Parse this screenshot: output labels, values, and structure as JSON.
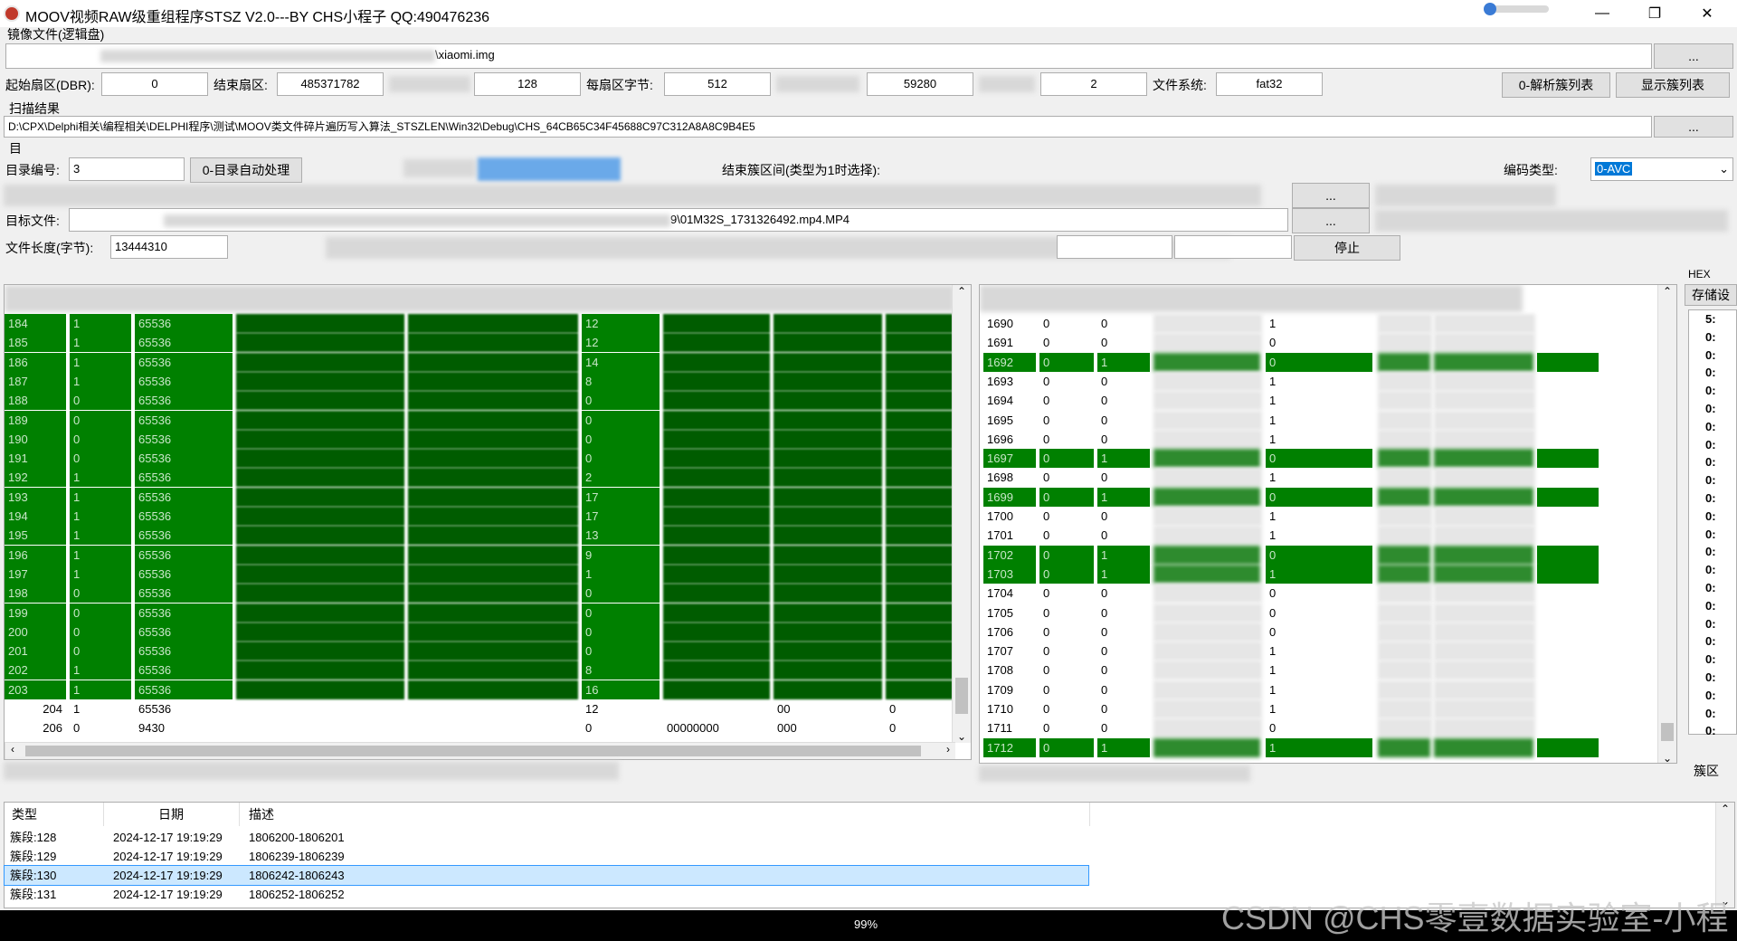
{
  "window": {
    "title": "MOOV视频RAW级重组程序STSZ V2.0---BY CHS小程子  QQ:490476236",
    "minimize": "—",
    "maximize": "❐",
    "close": "✕"
  },
  "image_section": {
    "label": "镜像文件(逻辑盘)",
    "path": "\\xiaomi.img",
    "browse": "..."
  },
  "params": {
    "start_sector_label": "起始扇区(DBR):",
    "start_sector": "0",
    "end_sector_label": "结束扇区:",
    "end_sector": "485371782",
    "field3": "128",
    "bytes_per_sector_label": "每扇区字节:",
    "bytes_per_sector": "512",
    "field5": "59280",
    "field6": "2",
    "fs_label": "文件系统:",
    "fs": "fat32",
    "parse_button": "0-解析簇列表",
    "show_button": "显示簇列表"
  },
  "scan": {
    "label": "扫描结果",
    "path": "D:\\CPX\\Delphi相关\\编程相关\\DELPHI程序\\测试\\MOOV类文件碎片遍历写入算法_STSZLEN\\Win32\\Debug\\CHS_64CB65C34F45688C97C312A8A8C9B4E5",
    "browse": "..."
  },
  "dir": {
    "small_label": "目",
    "dir_no_label": "目录编号:",
    "dir_no": "3",
    "auto_button": "0-目录自动处理",
    "end_range_label": "结束簇区间(类型为1时选择):",
    "encode_label": "编码类型:",
    "encode_value": "0-AVC"
  },
  "target": {
    "label": "目标文件:",
    "path": "9\\01M32S_1731326492.mp4.MP4",
    "browse1": "...",
    "browse2": "...",
    "length_label": "文件长度(字节):",
    "length": "13444310",
    "stop_button": "停止"
  },
  "left_grid": {
    "rows": [
      {
        "id": "184",
        "a": "1",
        "b": "65536",
        "c": "12",
        "green": true
      },
      {
        "id": "185",
        "a": "1",
        "b": "65536",
        "c": "12",
        "green": true
      },
      {
        "id": "186",
        "a": "1",
        "b": "65536",
        "c": "14",
        "green": true
      },
      {
        "id": "187",
        "a": "1",
        "b": "65536",
        "c": "8",
        "green": true
      },
      {
        "id": "188",
        "a": "0",
        "b": "65536",
        "c": "0",
        "green": true
      },
      {
        "id": "189",
        "a": "0",
        "b": "65536",
        "c": "0",
        "green": true
      },
      {
        "id": "190",
        "a": "0",
        "b": "65536",
        "c": "0",
        "green": true
      },
      {
        "id": "191",
        "a": "0",
        "b": "65536",
        "c": "0",
        "green": true
      },
      {
        "id": "192",
        "a": "1",
        "b": "65536",
        "c": "2",
        "green": true
      },
      {
        "id": "193",
        "a": "1",
        "b": "65536",
        "c": "17",
        "green": true
      },
      {
        "id": "194",
        "a": "1",
        "b": "65536",
        "c": "17",
        "green": true
      },
      {
        "id": "195",
        "a": "1",
        "b": "65536",
        "c": "13",
        "green": true
      },
      {
        "id": "196",
        "a": "1",
        "b": "65536",
        "c": "9",
        "green": true
      },
      {
        "id": "197",
        "a": "1",
        "b": "65536",
        "c": "1",
        "green": true
      },
      {
        "id": "198",
        "a": "0",
        "b": "65536",
        "c": "0",
        "green": true
      },
      {
        "id": "199",
        "a": "0",
        "b": "65536",
        "c": "0",
        "green": true
      },
      {
        "id": "200",
        "a": "0",
        "b": "65536",
        "c": "0",
        "green": true
      },
      {
        "id": "201",
        "a": "0",
        "b": "65536",
        "c": "0",
        "green": true
      },
      {
        "id": "202",
        "a": "1",
        "b": "65536",
        "c": "8",
        "green": true
      },
      {
        "id": "203",
        "a": "1",
        "b": "65536",
        "c": "16",
        "green": true
      },
      {
        "id": "204",
        "a": "1",
        "b": "65536",
        "c": "12",
        "green": false
      },
      {
        "id": "206",
        "a": "0",
        "b": "9430",
        "c": "0",
        "green": false
      }
    ],
    "row204_d": "00",
    "row204_e": "0",
    "row206_zeros": "00000000",
    "row206_d": "000",
    "row206_e": "0"
  },
  "right_grid": {
    "rows": [
      {
        "id": "1690",
        "a": "0",
        "b": "0",
        "c": "1",
        "green": false
      },
      {
        "id": "1691",
        "a": "0",
        "b": "0",
        "c": "0",
        "green": false
      },
      {
        "id": "1692",
        "a": "0",
        "b": "1",
        "c": "0",
        "green": true
      },
      {
        "id": "1693",
        "a": "0",
        "b": "0",
        "c": "1",
        "green": false
      },
      {
        "id": "1694",
        "a": "0",
        "b": "0",
        "c": "1",
        "green": false
      },
      {
        "id": "1695",
        "a": "0",
        "b": "0",
        "c": "1",
        "green": false
      },
      {
        "id": "1696",
        "a": "0",
        "b": "0",
        "c": "1",
        "green": false
      },
      {
        "id": "1697",
        "a": "0",
        "b": "1",
        "c": "0",
        "green": true
      },
      {
        "id": "1698",
        "a": "0",
        "b": "0",
        "c": "1",
        "green": false
      },
      {
        "id": "1699",
        "a": "0",
        "b": "1",
        "c": "0",
        "green": true
      },
      {
        "id": "1700",
        "a": "0",
        "b": "0",
        "c": "1",
        "green": false
      },
      {
        "id": "1701",
        "a": "0",
        "b": "0",
        "c": "1",
        "green": false
      },
      {
        "id": "1702",
        "a": "0",
        "b": "1",
        "c": "0",
        "green": true
      },
      {
        "id": "1703",
        "a": "0",
        "b": "1",
        "c": "1",
        "green": true
      },
      {
        "id": "1704",
        "a": "0",
        "b": "0",
        "c": "0",
        "green": false
      },
      {
        "id": "1705",
        "a": "0",
        "b": "0",
        "c": "0",
        "green": false
      },
      {
        "id": "1706",
        "a": "0",
        "b": "0",
        "c": "0",
        "green": false
      },
      {
        "id": "1707",
        "a": "0",
        "b": "0",
        "c": "1",
        "green": false
      },
      {
        "id": "1708",
        "a": "0",
        "b": "0",
        "c": "1",
        "green": false
      },
      {
        "id": "1709",
        "a": "0",
        "b": "0",
        "c": "1",
        "green": false
      },
      {
        "id": "1710",
        "a": "0",
        "b": "0",
        "c": "1",
        "green": false
      },
      {
        "id": "1711",
        "a": "0",
        "b": "0",
        "c": "0",
        "green": false
      },
      {
        "id": "1712",
        "a": "0",
        "b": "1",
        "c": "1",
        "green": true
      }
    ]
  },
  "side": {
    "hex_label": "HEX",
    "store_button": "存储设",
    "hex_values": [
      "5:",
      "0:",
      "0:",
      "0:",
      "0:",
      "0:",
      "0:",
      "0:",
      "0:",
      "0:",
      "0:",
      "0:",
      "0:",
      "0:",
      "0:",
      "0:",
      "0:",
      "0:",
      "0:",
      "0:",
      "0:",
      "0:",
      "0:",
      "0:"
    ],
    "bottom_label": "簇区"
  },
  "log": {
    "headers": [
      "类型",
      "日期",
      "描述"
    ],
    "rows": [
      {
        "type": "簇段:128",
        "date": "2024-12-17 19:19:29",
        "desc": "1806200-1806201",
        "selected": false
      },
      {
        "type": "簇段:129",
        "date": "2024-12-17 19:19:29",
        "desc": "1806239-1806239",
        "selected": false
      },
      {
        "type": "簇段:130",
        "date": "2024-12-17 19:19:29",
        "desc": "1806242-1806243",
        "selected": true
      },
      {
        "type": "簇段:131",
        "date": "2024-12-17 19:19:29",
        "desc": "1806252-1806252",
        "selected": false
      }
    ]
  },
  "status": {
    "progress": "99%"
  },
  "watermark": "CSDN @CHS零壹数据实验室-小程",
  "colors": {
    "green_row": "#008000",
    "selection": "#cce8ff",
    "close_red": "#c0392b"
  }
}
